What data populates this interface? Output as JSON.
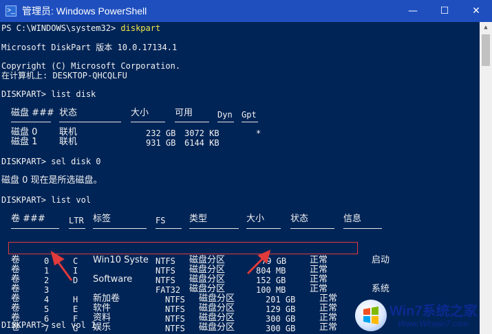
{
  "window": {
    "title": "管理员: Windows PowerShell",
    "app_icon": "powershell-icon",
    "minimize_glyph": "—",
    "maximize_glyph": "☐",
    "close_glyph": "✕"
  },
  "console": {
    "l1_prompt": "PS C:\\WINDOWS\\system32> ",
    "l1_cmd": "diskpart",
    "l2": "Microsoft DiskPart 版本 10.0.17134.1",
    "l3": "Copyright (C) Microsoft Corporation.",
    "l4": "在计算机上: DESKTOP-QHCQLFU",
    "l5": "DISKPART> list disk",
    "disk_headers": [
      "磁盘 ###",
      "状态",
      "大小",
      "可用",
      "Dyn",
      "Gpt"
    ],
    "disks": [
      {
        "num": "磁盘 0",
        "status": "联机",
        "size": "232 GB",
        "free": "3072 KB",
        "dyn": "",
        "gpt": "*"
      },
      {
        "num": "磁盘 1",
        "status": "联机",
        "size": "931 GB",
        "free": "6144 KB",
        "dyn": "",
        "gpt": ""
      }
    ],
    "l6": "DISKPART> sel disk 0",
    "l7": "磁盘 0 现在是所选磁盘。",
    "l8": "DISKPART> list vol",
    "vol_headers": [
      "卷 ###",
      "LTR",
      "标签",
      "FS",
      "类型",
      "大小",
      "状态",
      "信息"
    ],
    "vols": [
      {
        "vol": "卷",
        "num": "0",
        "ltr": "C",
        "label": "Win10 Syste",
        "fs": "NTFS",
        "type": "磁盘分区",
        "size": "79 GB",
        "status": "正常",
        "info": "启动"
      },
      {
        "vol": "卷",
        "num": "1",
        "ltr": "I",
        "label": "",
        "fs": "NTFS",
        "type": "磁盘分区",
        "size": "804 MB",
        "status": "正常",
        "info": ""
      },
      {
        "vol": "卷",
        "num": "2",
        "ltr": "D",
        "label": "Software",
        "fs": "NTFS",
        "type": "磁盘分区",
        "size": "152 GB",
        "status": "正常",
        "info": ""
      },
      {
        "vol": "卷",
        "num": "3",
        "ltr": "",
        "label": "",
        "fs": "FAT32",
        "type": "磁盘分区",
        "size": "100 MB",
        "status": "正常",
        "info": "系统"
      },
      {
        "vol": "卷",
        "num": "4",
        "ltr": "H",
        "label": "新加卷",
        "fs": "NTFS",
        "type": "磁盘分区",
        "size": "201 GB",
        "status": "正常",
        "info": ""
      },
      {
        "vol": "卷",
        "num": "5",
        "ltr": "E",
        "label": "软件",
        "fs": "NTFS",
        "type": "磁盘分区",
        "size": "129 GB",
        "status": "正常",
        "info": ""
      },
      {
        "vol": "卷",
        "num": "6",
        "ltr": "F",
        "label": "资料",
        "fs": "NTFS",
        "type": "磁盘分区",
        "size": "300 GB",
        "status": "正常",
        "info": ""
      },
      {
        "vol": "卷",
        "num": "7",
        "ltr": "G",
        "label": "娱乐",
        "fs": "NTFS",
        "type": "磁盘分区",
        "size": "300 GB",
        "status": "正常",
        "info": ""
      }
    ],
    "l9": "DISKPART> sel vol 1"
  },
  "watermark": {
    "brand": "Win7系统之家",
    "url": "Www.Winwin7.com"
  },
  "colors": {
    "console_bg": "#012456",
    "console_text": "#f2f2f2",
    "command_text": "#f2e94e",
    "title_bar": "#1f4fbf",
    "highlight": "#e03a3a"
  }
}
